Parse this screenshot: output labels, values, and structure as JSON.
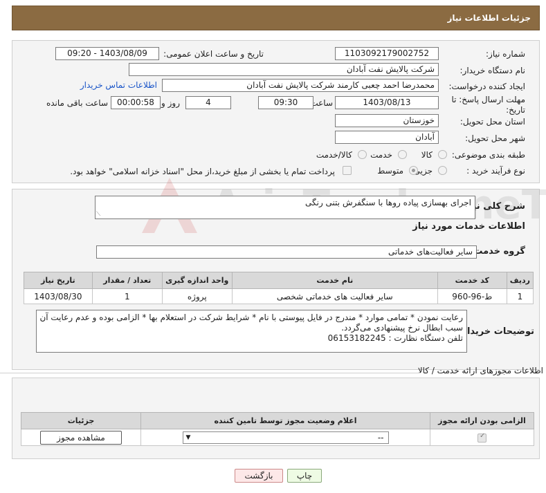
{
  "header": {
    "title": "جزئیات اطلاعات نیاز"
  },
  "need_info": {
    "need_number_label": "شماره نیاز:",
    "need_number": "1103092179002752",
    "announce_label": "تاریخ و ساعت اعلان عمومی:",
    "announce_value": "1403/08/09 - 09:20",
    "buyer_org_label": "نام دستگاه خریدار:",
    "buyer_org": "شرکت پالایش نفت آبادان",
    "creator_label": "ایجاد کننده درخواست:",
    "creator": "محمدرضا احمد چعبی کارمند شرکت پالایش نفت آبادان",
    "contact_link": "اطلاعات تماس خریدار",
    "deadline_label": "مهلت ارسال پاسخ: تا تاریخ:",
    "deadline_date": "1403/08/13",
    "time_label": "ساعت",
    "deadline_time": "09:30",
    "days_value": "4",
    "days_label": "روز و",
    "remaining_time": "00:00:58",
    "remaining_label": "ساعت باقی مانده",
    "province_label": "استان محل تحویل:",
    "province": "خوزستان",
    "city_label": "شهر محل تحویل:",
    "city": "آبادان",
    "category_label": "طبقه بندی موضوعی:",
    "category_options": [
      "کالا",
      "خدمت",
      "کالا/خدمت"
    ],
    "category_selected": "خدمت",
    "process_label": "نوع فرآیند خرید :",
    "process_options": [
      "جزیی",
      "متوسط"
    ],
    "process_selected": "جزیی",
    "payment_note": "پرداخت تمام یا بخشی از مبلغ خرید،از محل \"اسناد خزانه اسلامی\" خواهد بود."
  },
  "description": {
    "summary_label": "شرح کلی نیاز:",
    "summary": "اجرای بهسازی پیاده روها با سنگفرش بتنی رنگی",
    "services_heading": "اطلاعات خدمات مورد نیاز",
    "service_group_label": "گروه خدمت:",
    "service_group": "سایر فعالیت‌های خدماتی"
  },
  "services_table": {
    "headers": [
      "ردیف",
      "کد خدمت",
      "نام خدمت",
      "واحد اندازه گیری",
      "تعداد / مقدار",
      "تاریخ نیاز"
    ],
    "rows": [
      [
        "1",
        "ط-96-960",
        "سایر فعالیت های خدماتی شخصی",
        "پروژه",
        "1",
        "1403/08/30"
      ]
    ]
  },
  "buyer_notes": {
    "label": "توضیحات خریدار:",
    "line1": "رعایت نمودن * تمامی موارد * مندرج در فایل پیوستی با نام * شرایط شرکت در استعلام بها * الزامی بوده و عدم رعایت آن",
    "line2": "سبب ابطال نرخ پیشنهادی می‌گردد.",
    "line3": "تلفن دستگاه نظارت : 06153182245"
  },
  "permits": {
    "section_title": "اطلاعات مجوزهای ارائه خدمت / کالا",
    "headers": [
      "الزامی بودن ارائه مجوز",
      "اعلام وضعیت مجوز توسط تامین کننده",
      "جزئیات"
    ],
    "select_value": "--",
    "view_button": "مشاهده مجوز"
  },
  "actions": {
    "print": "چاپ",
    "back": "بازگشت"
  },
  "watermark": {
    "text": "AriaTender.neT"
  }
}
